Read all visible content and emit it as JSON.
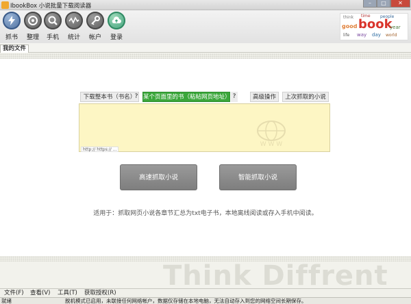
{
  "window": {
    "title": "IbookBox 小说批量下载阅读器",
    "controls": {
      "minimize": "–",
      "maximize": "□",
      "close": "✕"
    }
  },
  "toolbar": {
    "items": [
      {
        "label": "抓书",
        "icon": "lightning-icon"
      },
      {
        "label": "整理",
        "icon": "disc-icon"
      },
      {
        "label": "手机",
        "icon": "search-icon"
      },
      {
        "label": "统计",
        "icon": "wave-icon"
      },
      {
        "label": "帐户",
        "icon": "key-icon"
      },
      {
        "label": "登录",
        "icon": "cloud-upload-icon"
      }
    ],
    "logo_words": [
      "book",
      "time",
      "think",
      "good",
      "people",
      "year",
      "life",
      "way",
      "day",
      "world"
    ]
  },
  "file_tab": {
    "label": "我的文件"
  },
  "search_tabs": [
    {
      "label": "下载整本书（书名）",
      "active": false
    },
    {
      "label": "某个页面里的书（粘帖网页地址）",
      "active": true
    },
    {
      "label": "高级操作",
      "active": false
    },
    {
      "label": "上次抓取的小说",
      "active": false
    }
  ],
  "search_help": "?",
  "url_input": {
    "value": "",
    "placeholder": "",
    "hint": "http:// https:// ..."
  },
  "globe_text": "W W W",
  "buttons": {
    "fast": "高速抓取小说",
    "smart": "智能抓取小说"
  },
  "note": "适用于：抓取网页小说各章节汇总为txt电子书，本地离线阅读或存入手机中阅读。",
  "watermark": "Think Diffrent",
  "menu": [
    {
      "label": "文件(F)"
    },
    {
      "label": "查看(V)"
    },
    {
      "label": "工具(T)"
    },
    {
      "label": "获取授权(R)"
    }
  ],
  "status": {
    "left": "就绪",
    "message": "脱机模式已启用，未联接任何网络帐户，数据仅存储在本地电脑，无法自动存入到您的网络空间长期保存。"
  },
  "colors": {
    "accent": "#3aa63a",
    "input_bg": "#fdf6c4",
    "button_bg": "#8c8c8c"
  }
}
